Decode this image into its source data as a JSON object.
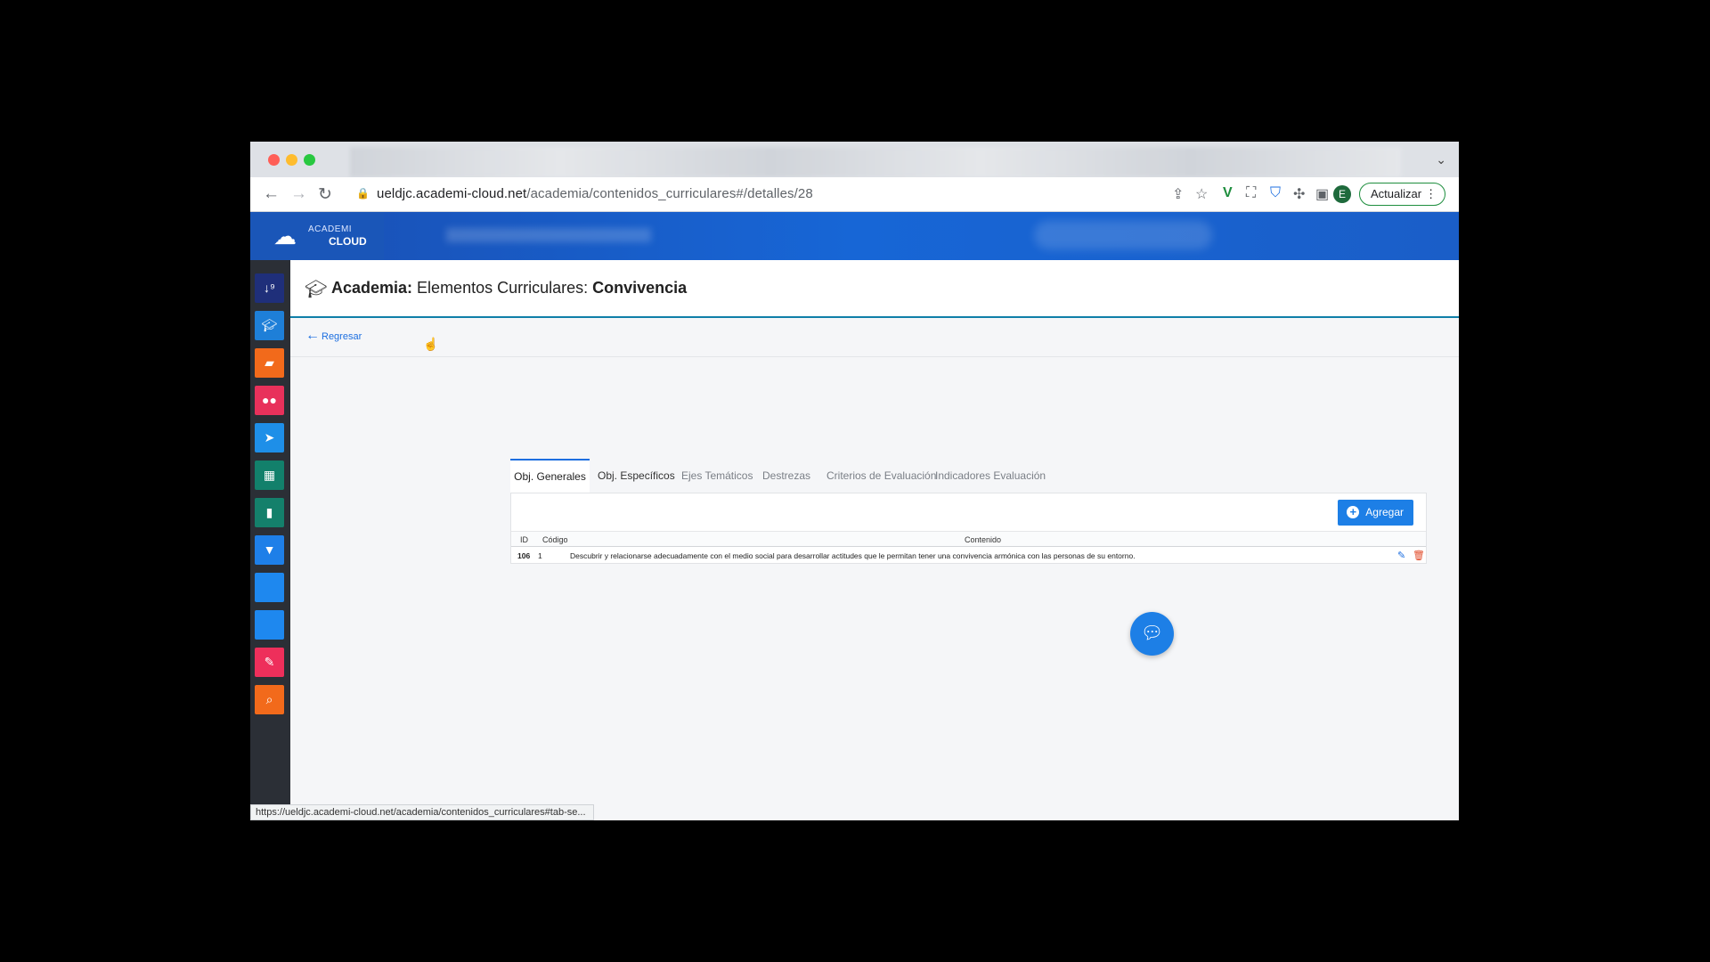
{
  "browser": {
    "url_host": "ueldjc.academi-cloud.net",
    "url_path": "/academia/contenidos_curriculares#/detalles/28",
    "profile_initial": "E",
    "update_label": "Actualizar",
    "status_url": "https://ueldjc.academi-cloud.net/academia/contenidos_curriculares#tab-se..."
  },
  "app": {
    "logo_line1": "ACADEMI",
    "logo_line2": "CLOUD"
  },
  "sidebar": {
    "items": [
      {
        "icon": "sort-icon",
        "color": "#1f2f7a"
      },
      {
        "icon": "graduation-cap-icon",
        "color": "#1e7fd8"
      },
      {
        "icon": "folder-open-icon",
        "color": "#f26a1b"
      },
      {
        "icon": "users-icon",
        "color": "#e8315b"
      },
      {
        "icon": "paper-plane-icon",
        "color": "#1e8fe8"
      },
      {
        "icon": "calendar-icon",
        "color": "#12806b"
      },
      {
        "icon": "book-icon",
        "color": "#14806b"
      },
      {
        "icon": "bookmark-icon",
        "color": "#1e7fe8"
      },
      {
        "icon": "blank-icon",
        "color": "#1e88ef"
      },
      {
        "icon": "blank-icon",
        "color": "#1e88ef"
      },
      {
        "icon": "edit-icon",
        "color": "#ee2f5b"
      },
      {
        "icon": "search-icon",
        "color": "#f26a1b"
      }
    ]
  },
  "page": {
    "title_prefix": "Academia:",
    "title_middle": " Elementos Curriculares: ",
    "title_bold": "Convivencia",
    "back_label": "Regresar"
  },
  "tabs": [
    {
      "label": "Obj. Generales",
      "active": true
    },
    {
      "label": "Obj. Específicos",
      "active": false
    },
    {
      "label": "Ejes Temáticos",
      "active": false
    },
    {
      "label": "Destrezas",
      "active": false
    },
    {
      "label": "Criterios de Evaluación",
      "active": false
    },
    {
      "label": "Indicadores Evaluación",
      "active": false
    }
  ],
  "table": {
    "add_label": "Agregar",
    "headers": {
      "id": "ID",
      "code": "Código",
      "content": "Contenido"
    },
    "rows": [
      {
        "id": "106",
        "code": "1",
        "content": "Descubrir y relacionarse adecuadamente con el medio social para desarrollar actitudes que le permitan tener una convivencia armónica con las personas de su entorno."
      }
    ]
  },
  "colors": {
    "accent": "#1d7fe6",
    "header_blue": "#1766d6",
    "delete_red": "#e14b2a"
  }
}
